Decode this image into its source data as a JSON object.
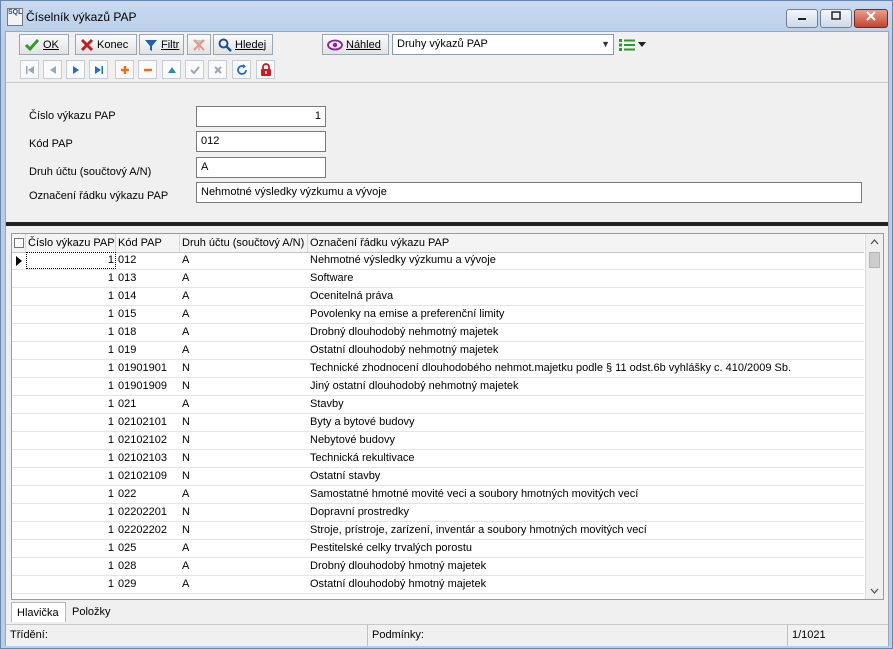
{
  "window": {
    "title": "Číselník výkazů PAP",
    "app_icon_text": "SQL",
    "minimize_icon": "minimize-icon",
    "maximize_icon": "maximize-icon",
    "close_icon": "close-icon"
  },
  "toolbar": {
    "ok_label": "OK",
    "end_label": "Konec",
    "filter_label": "Filtr",
    "search_label": "Hledej",
    "preview_label": "Náhled",
    "report_combo_value": "Druhy výkazů PAP"
  },
  "form": {
    "fields": [
      {
        "label": "Číslo výkazu PAP",
        "value": "1"
      },
      {
        "label": "Kód PAP",
        "value": "012"
      },
      {
        "label": "Druh účtu (součtový A/N)",
        "value": "A"
      },
      {
        "label": "Označení řádku výkazu PAP",
        "value": "Nehmotné výsledky výzkumu a vývoje"
      }
    ]
  },
  "grid": {
    "columns": [
      "Číslo výkazu PAP",
      "Kód PAP",
      "Druh účtu (součtový A/N)",
      "Označení řádku výkazu PAP"
    ],
    "rows": [
      [
        "1",
        "012",
        "A",
        "Nehmotné výsledky výzkumu a vývoje"
      ],
      [
        "1",
        "013",
        "A",
        "Software"
      ],
      [
        "1",
        "014",
        "A",
        "Ocenitelná práva"
      ],
      [
        "1",
        "015",
        "A",
        "Povolenky na emise a preferenční limity"
      ],
      [
        "1",
        "018",
        "A",
        "Drobný dlouhodobý nehmotný majetek"
      ],
      [
        "1",
        "019",
        "A",
        "Ostatní dlouhodobý nehmotný majetek"
      ],
      [
        "1",
        "01901901",
        "N",
        "Technické zhodnocení dlouhodobého nehmot.majetku podle § 11 odst.6b vyhlášky c. 410/2009 Sb."
      ],
      [
        "1",
        "01901909",
        "N",
        "Jiný ostatní dlouhodobý nehmotný majetek"
      ],
      [
        "1",
        "021",
        "A",
        "Stavby"
      ],
      [
        "1",
        "02102101",
        "N",
        "Byty a bytové budovy"
      ],
      [
        "1",
        "02102102",
        "N",
        "Nebytové budovy"
      ],
      [
        "1",
        "02102103",
        "N",
        "Technická rekultivace"
      ],
      [
        "1",
        "02102109",
        "N",
        "Ostatní stavby"
      ],
      [
        "1",
        "022",
        "A",
        "Samostatné hmotné movité veci a soubory hmotných movitých vecí"
      ],
      [
        "1",
        "02202201",
        "N",
        "Dopravní prostredky"
      ],
      [
        "1",
        "02202202",
        "N",
        "Stroje, prístroje, zarízení, inventár a soubory hmotných movitých vecí"
      ],
      [
        "1",
        "025",
        "A",
        "Pestitelské celky trvalých porostu"
      ],
      [
        "1",
        "028",
        "A",
        "Drobný dlouhodobý hmotný majetek"
      ],
      [
        "1",
        "029",
        "A",
        "Ostatní dlouhodobý hmotný majetek"
      ]
    ]
  },
  "tabs": [
    "Hlavička",
    "Položky"
  ],
  "status": {
    "sort_label": "Třídění:",
    "conditions_label": "Podmínky:",
    "record_counter": "1/1021"
  },
  "colors": {
    "ok_green": "#2e9a2e",
    "end_red": "#c02020",
    "filter_blue": "#1f5fb0",
    "preview_purple": "#8b1fa8",
    "nav_blue": "#1e6fd0",
    "add_orange": "#e8701c",
    "lock_red": "#d8141d"
  }
}
